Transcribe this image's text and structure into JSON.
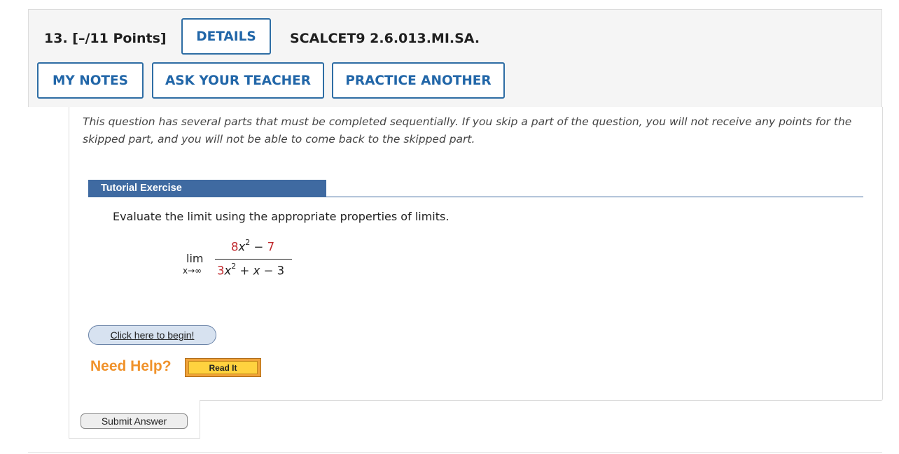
{
  "header": {
    "question_number": "13.",
    "points": "[–/11 Points]",
    "details_label": "DETAILS",
    "code": "SCALCET9 2.6.013.MI.SA.",
    "my_notes_label": "MY NOTES",
    "ask_teacher_label": "ASK YOUR TEACHER",
    "practice_another_label": "PRACTICE ANOTHER"
  },
  "instructions": "This question has several parts that must be completed sequentially. If you skip a part of the question, you will not receive any points for the skipped part, and you will not be able to come back to the skipped part.",
  "tutorial": {
    "header": "Tutorial Exercise",
    "prompt": "Evaluate the limit using the appropriate properties of limits.",
    "math": {
      "lim": "lim",
      "subscript": "x→∞",
      "numerator": {
        "coef": "8",
        "var": "x",
        "exp": "2",
        "op": " − ",
        "const": "7"
      },
      "denominator": {
        "coef": "3",
        "var": "x",
        "exp": "2",
        "rest_op1": " + ",
        "rest_var": "x",
        "rest_op2": " − 3"
      }
    },
    "begin_label": "Click here to begin!",
    "need_help_label": "Need Help?",
    "read_it_label": "Read It"
  },
  "submit_label": "Submit Answer",
  "colors": {
    "accent_blue": "#2166a8",
    "tutorial_header": "#3f6aa1",
    "highlight_red": "#c0282c",
    "help_orange": "#f0922b"
  }
}
